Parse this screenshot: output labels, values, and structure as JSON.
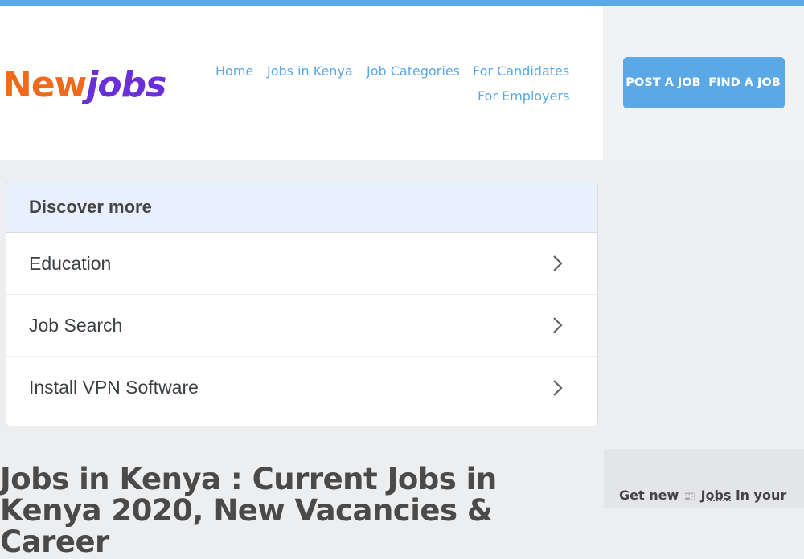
{
  "header": {
    "logo_part1": "New",
    "logo_part2": "jobs",
    "nav": {
      "home": "Home",
      "jobs_in_kenya": "Jobs in Kenya",
      "job_categories": "Job Categories",
      "for_candidates": "For Candidates",
      "for_employers": "For Employers"
    },
    "post_job": "POST A JOB",
    "find_job": "FIND A JOB"
  },
  "discover": {
    "title": "Discover more",
    "items": [
      {
        "label": "Education"
      },
      {
        "label": "Job Search"
      },
      {
        "label": "Install VPN Software"
      }
    ]
  },
  "page": {
    "title": "Jobs in Kenya : Current Jobs in Kenya 2020, New Vacancies & Career"
  },
  "sidebar": {
    "widget_prefix": "Get new",
    "widget_icon": "📰",
    "widget_link": "Jobs",
    "widget_suffix": "in your"
  },
  "colors": {
    "accent": "#5aa9e6",
    "logo_orange": "#f06a1d",
    "logo_purple": "#6b2fd8"
  }
}
